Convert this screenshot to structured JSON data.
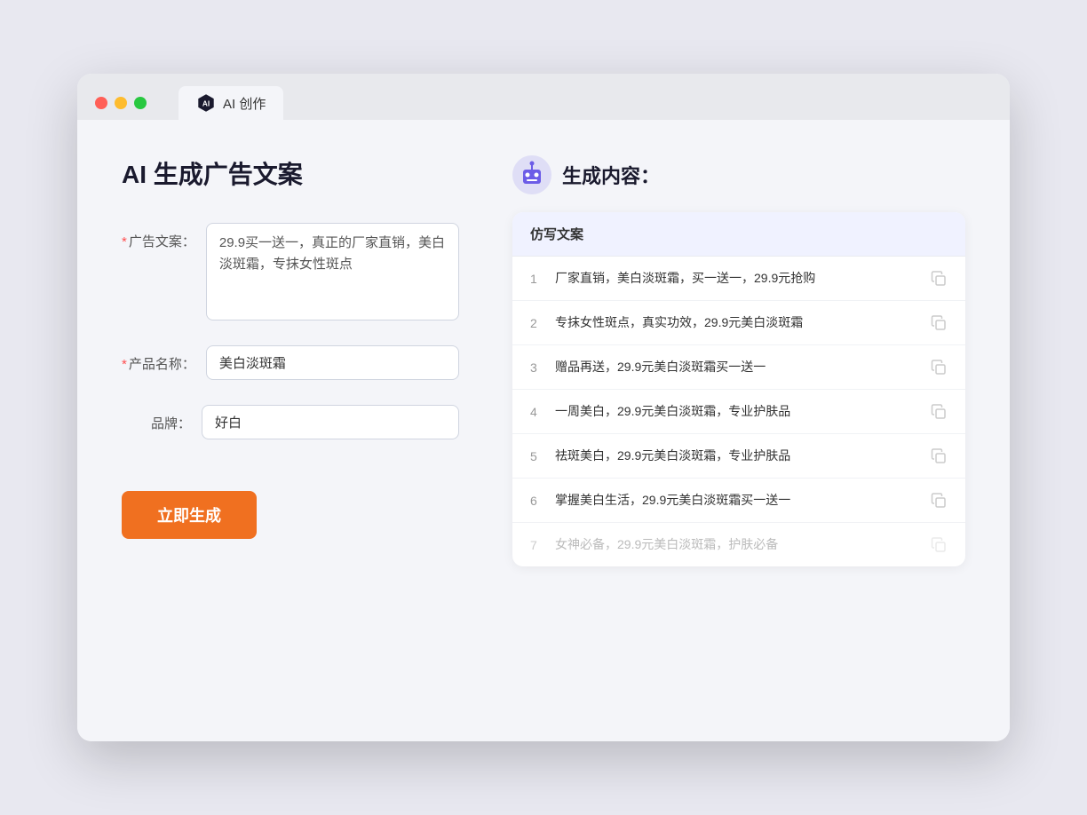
{
  "browser": {
    "tab_label": "AI 创作"
  },
  "left_panel": {
    "page_title": "AI 生成广告文案",
    "form": {
      "ad_copy_label": "广告文案：",
      "ad_copy_required": "*",
      "ad_copy_value": "29.9买一送一，真正的厂家直销，美白淡斑霜，专抹女性斑点",
      "product_name_label": "产品名称：",
      "product_name_required": "*",
      "product_name_value": "美白淡斑霜",
      "brand_label": "品牌：",
      "brand_value": "好白",
      "generate_button": "立即生成"
    }
  },
  "right_panel": {
    "result_title": "生成内容：",
    "table_header": "仿写文案",
    "rows": [
      {
        "num": "1",
        "text": "厂家直销，美白淡斑霜，买一送一，29.9元抢购",
        "muted": false
      },
      {
        "num": "2",
        "text": "专抹女性斑点，真实功效，29.9元美白淡斑霜",
        "muted": false
      },
      {
        "num": "3",
        "text": "赠品再送，29.9元美白淡斑霜买一送一",
        "muted": false
      },
      {
        "num": "4",
        "text": "一周美白，29.9元美白淡斑霜，专业护肤品",
        "muted": false
      },
      {
        "num": "5",
        "text": "祛斑美白，29.9元美白淡斑霜，专业护肤品",
        "muted": false
      },
      {
        "num": "6",
        "text": "掌握美白生活，29.9元美白淡斑霜买一送一",
        "muted": false
      },
      {
        "num": "7",
        "text": "女神必备，29.9元美白淡斑霜，护肤必备",
        "muted": true
      }
    ]
  }
}
